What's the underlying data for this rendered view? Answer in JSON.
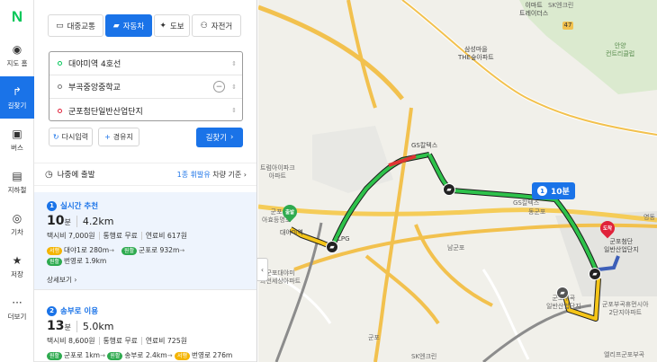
{
  "rail": {
    "logo": "N",
    "items": [
      {
        "label": "지도 홈",
        "icon": "map-pin-icon",
        "glyph": "◉"
      },
      {
        "label": "길찾기",
        "icon": "directions-icon",
        "glyph": "↱"
      },
      {
        "label": "버스",
        "icon": "bus-icon",
        "glyph": "▣"
      },
      {
        "label": "지하철",
        "icon": "subway-icon",
        "glyph": "▤"
      },
      {
        "label": "기차",
        "icon": "train-icon",
        "glyph": "◎"
      },
      {
        "label": "저장",
        "icon": "star-icon",
        "glyph": "★"
      },
      {
        "label": "더보기",
        "icon": "more-icon",
        "glyph": "···"
      }
    ]
  },
  "modes": [
    {
      "label": "대중교통",
      "icon": "bus-icon",
      "glyph": "▭"
    },
    {
      "label": "자동차",
      "icon": "car-icon",
      "glyph": "▰"
    },
    {
      "label": "도보",
      "icon": "walk-icon",
      "glyph": "✦"
    },
    {
      "label": "자전거",
      "icon": "bicycle-icon",
      "glyph": "⚇"
    }
  ],
  "route": {
    "start": "대야미역 4호선",
    "waypoint": "부곡중앙중학교",
    "end": "군포첨단일반산업단지"
  },
  "buttons": {
    "reset": "다시입력",
    "waypoint": "경유지",
    "search": "길찾기"
  },
  "depart": {
    "label": "나중에 출발",
    "toll_class": "1종 휘발유",
    "toll_suffix": "차량 기준"
  },
  "results": [
    {
      "index": "1",
      "title": "실시간 추천",
      "minutes": "10",
      "minute_unit": "분",
      "distance": "4.2km",
      "taxi": "택시비 7,000원",
      "toll": "통행료 무료",
      "fuel": "연료비 617원",
      "roads": [
        {
          "tag": "서행",
          "tag_color": "#f4b400",
          "name": "대야1로",
          "dist": "280m"
        },
        {
          "tag": "원활",
          "tag_color": "#2eaa4f",
          "name": "군포로",
          "dist": "932m"
        },
        {
          "tag": "원활",
          "tag_color": "#2eaa4f",
          "name": "번영로",
          "dist": "1.9km"
        }
      ],
      "detail": "상세보기"
    },
    {
      "index": "2",
      "title": "송부로 이용",
      "minutes": "13",
      "minute_unit": "분",
      "distance": "5.0km",
      "taxi": "택시비 8,600원",
      "toll": "통행료 무료",
      "fuel": "연료비 725원",
      "roads": [
        {
          "tag": "원활",
          "tag_color": "#2eaa4f",
          "name": "군포로",
          "dist": "1km"
        },
        {
          "tag": "원활",
          "tag_color": "#2eaa4f",
          "name": "송부로",
          "dist": "2.4km"
        },
        {
          "tag": "서행",
          "tag_color": "#f4b400",
          "name": "번영로",
          "dist": "276m"
        }
      ]
    }
  ],
  "map": {
    "badge_index": "1",
    "badge_time": "10분",
    "start_pin": "출발",
    "end_pin": "도착",
    "labels": [
      {
        "text": "SK엔크린"
      },
      {
        "text": "이마트\n트레이더스"
      },
      {
        "text": "삼성마을\nTHE숲아파트"
      },
      {
        "text": "안양\n컨트리클럽"
      },
      {
        "text": "GS칼텍스"
      },
      {
        "text": "트럼아이파크\n아파트"
      },
      {
        "text": "군포\n아효등명초"
      },
      {
        "text": "대야미역"
      },
      {
        "text": "LPG"
      },
      {
        "text": "군포대야미\n과천세상아파트"
      },
      {
        "text": "남군포"
      },
      {
        "text": "군포첨단\n일반산업단지"
      },
      {
        "text": "GS칼텍스"
      },
      {
        "text": "동군포"
      },
      {
        "text": "군포부곡휴먼시아\n2단지아파트"
      },
      {
        "text": "군포부곡\n일반산업단지"
      },
      {
        "text": "엘리프군포부곡"
      },
      {
        "text": "SK엔크린"
      },
      {
        "text": "47"
      },
      {
        "text": "영동"
      },
      {
        "text": "군포"
      }
    ]
  }
}
